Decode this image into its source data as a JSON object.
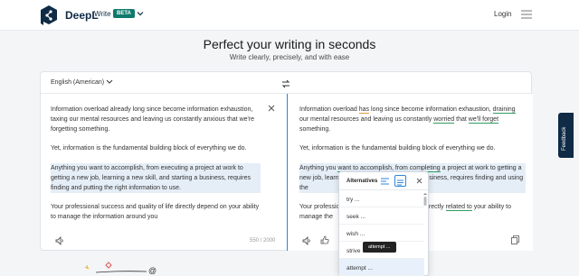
{
  "header": {
    "brand": "DeepL",
    "brand_sub": "Write",
    "beta": "BETA",
    "login": "Login"
  },
  "hero": {
    "title": "Perfect your writing in seconds",
    "subtitle": "Write clearly, precisely, and with ease"
  },
  "editor": {
    "language": "English (American)",
    "counter": "550 / 2000",
    "left": {
      "p1": "Information overload already long since become information exhaustion, taxing our mental resources and leaving us constantly anxious that we're forgetting something.",
      "p2": "Yet, information is the fundamental building block of everything we do.",
      "p3": "Anything you want to accomplish, from executing a project at work to getting a new job, learning a new skill, and starting a business, requires finding and putting the right information to use.",
      "p4": "Your professional success and quality of life directly depend on your ability to manage the information around you"
    },
    "right": {
      "p1_a": "Information overload ",
      "p1_b": "has",
      "p1_c": " long since become information exhaustion, ",
      "p1_d": "draining",
      "p1_e": " our mental resources and leaving us constantly ",
      "p1_f": "worried",
      "p1_g": " that ",
      "p1_h": "we'll forget",
      "p1_i": " something.",
      "p2": "Yet, information is the fundamental building block of everything we do.",
      "p3_a": "Anything you ",
      "p3_b": "want to",
      "p3_c": " accomplish, from ",
      "p3_d": "completing",
      "p3_e": " a project at work to getting a new job, learning a new skill, and starting a business, requires finding and using the",
      "p4_a": "Your professional success and quality of life directly ",
      "p4_b": "related to",
      "p4_c": " your ability to manage the"
    }
  },
  "popup": {
    "title": "Alternatives",
    "items": [
      "try ...",
      "seek ...",
      "wish ...",
      "strive ...",
      "attempt ..."
    ],
    "selected": "attempt ...",
    "tooltip": "attempt ..."
  },
  "feedback": "Feedback",
  "colors": {
    "brand": "#0f2b46",
    "beta": "#0f7a6c",
    "accent": "#2e86de",
    "highlight": "#e5eef7"
  }
}
